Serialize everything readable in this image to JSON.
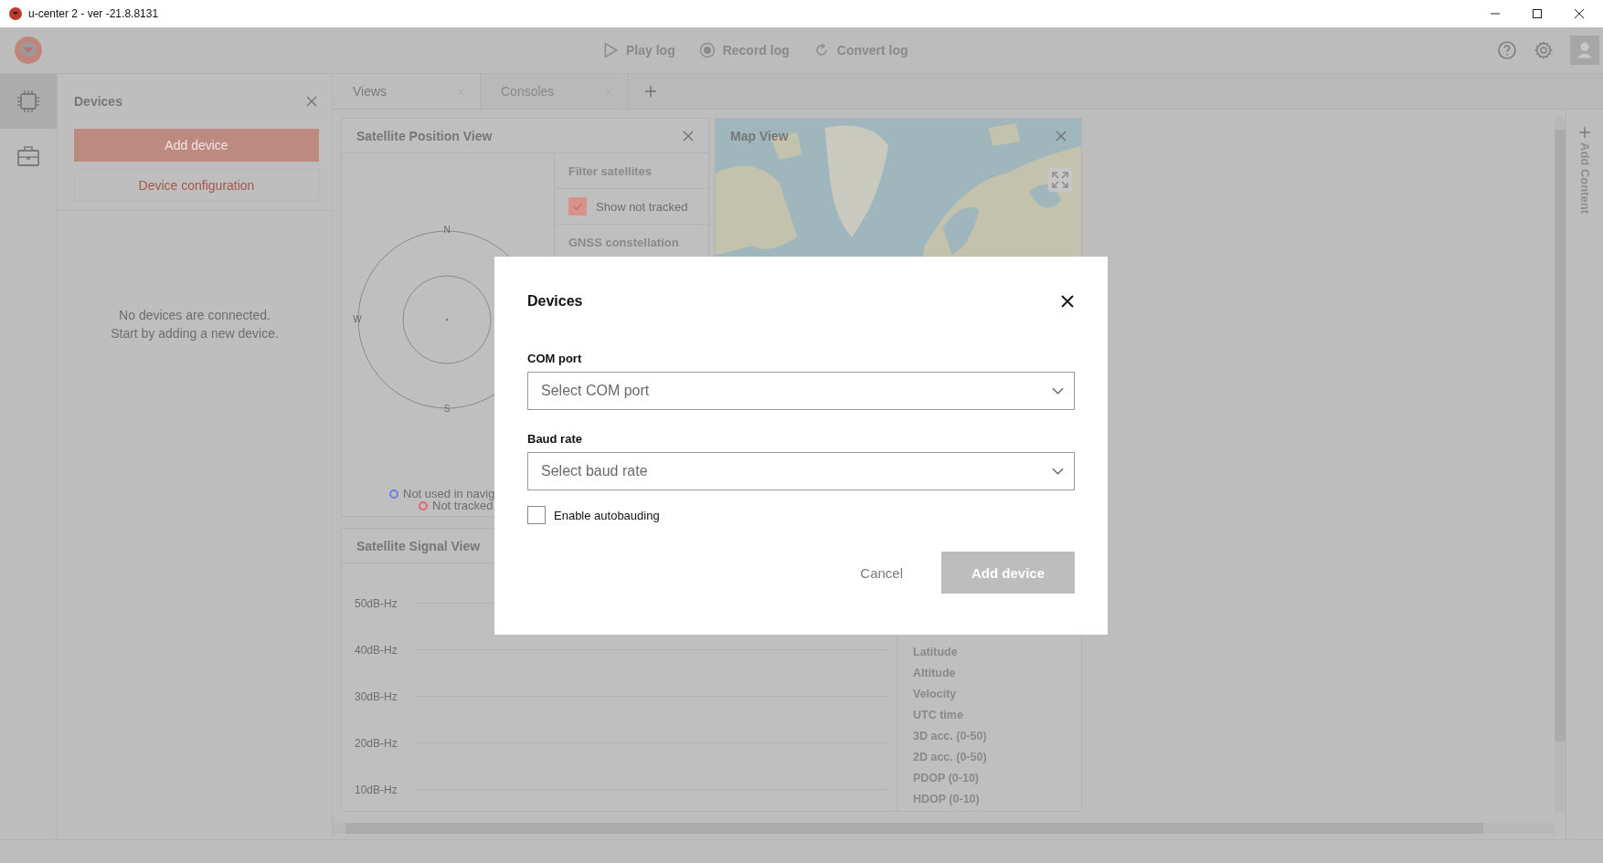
{
  "window": {
    "title": "u-center 2 - ver -21.8.8131"
  },
  "toolbar": {
    "actions": [
      {
        "label": "Play log"
      },
      {
        "label": "Record log"
      },
      {
        "label": "Convert log"
      }
    ]
  },
  "rail": [
    {
      "selected": true
    },
    {
      "selected": false
    }
  ],
  "devices_panel": {
    "title": "Devices",
    "add_button": "Add device",
    "config_button": "Device configuration",
    "empty_message": "No devices are connected.\nStart by adding a new device."
  },
  "tabs": [
    {
      "label": "Views",
      "selected": true
    },
    {
      "label": "Consoles",
      "selected": false
    }
  ],
  "satellite_position_view": {
    "title": "Satellite Position View",
    "compass": [
      "N",
      "W",
      "S"
    ],
    "filter": {
      "title": "Filter satellites",
      "option": {
        "label": "Show not tracked",
        "checked": true
      },
      "section": "GNSS constellation"
    },
    "legend": [
      {
        "label": "Not used in navig",
        "color": "#6f7fe0"
      },
      {
        "label": "Not tracked",
        "color": "#e06a6a"
      }
    ]
  },
  "map_view": {
    "title": "Map View"
  },
  "satellite_signal_view": {
    "title": "Satellite Signal View",
    "y_labels": [
      "50dB-Hz",
      "40dB-Hz",
      "30dB-Hz",
      "20dB-Hz",
      "10dB-Hz"
    ],
    "fields": [
      "Latitude",
      "Altitude",
      "Velocity",
      "UTC time",
      "3D acc. (0-50)",
      "2D acc. (0-50)",
      "PDOP (0-10)",
      "HDOP (0-10)"
    ]
  },
  "add_content": {
    "label": "Add Content"
  },
  "dialog": {
    "title": "Devices",
    "fields": [
      {
        "label": "COM port",
        "placeholder": "Select COM port"
      },
      {
        "label": "Baud rate",
        "placeholder": "Select baud rate"
      }
    ],
    "autobauding": {
      "label": "Enable autobauding",
      "checked": false
    },
    "buttons": [
      {
        "label": "Cancel",
        "kind": "secondary"
      },
      {
        "label": "Add device",
        "kind": "primary"
      }
    ]
  }
}
